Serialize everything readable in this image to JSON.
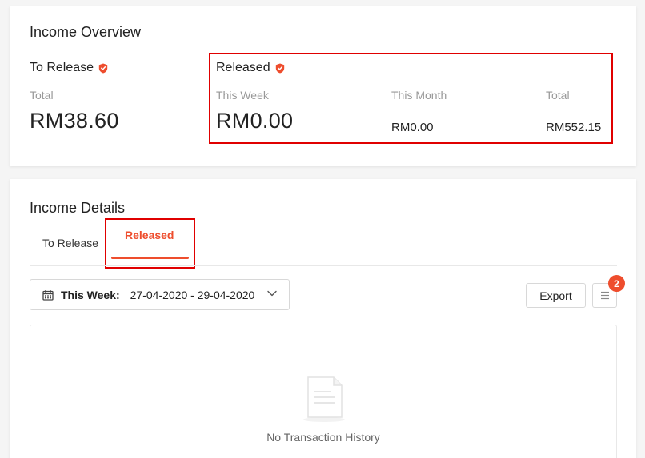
{
  "overview": {
    "title": "Income Overview",
    "to_release": {
      "heading": "To Release",
      "total_label": "Total",
      "total_value": "RM38.60"
    },
    "released": {
      "heading": "Released",
      "this_week_label": "This Week",
      "this_week_value": "RM0.00",
      "this_month_label": "This Month",
      "this_month_value": "RM0.00",
      "total_label": "Total",
      "total_value": "RM552.15"
    }
  },
  "details": {
    "title": "Income Details",
    "tabs": [
      {
        "label": "To Release",
        "active": false
      },
      {
        "label": "Released",
        "active": true
      }
    ],
    "date_filter": {
      "label": "This Week:",
      "range": "27-04-2020 - 29-04-2020"
    },
    "export_label": "Export",
    "filter_badge": "2",
    "empty_message": "No Transaction History"
  },
  "colors": {
    "accent": "#ee4d2d",
    "highlight": "#e00000"
  }
}
